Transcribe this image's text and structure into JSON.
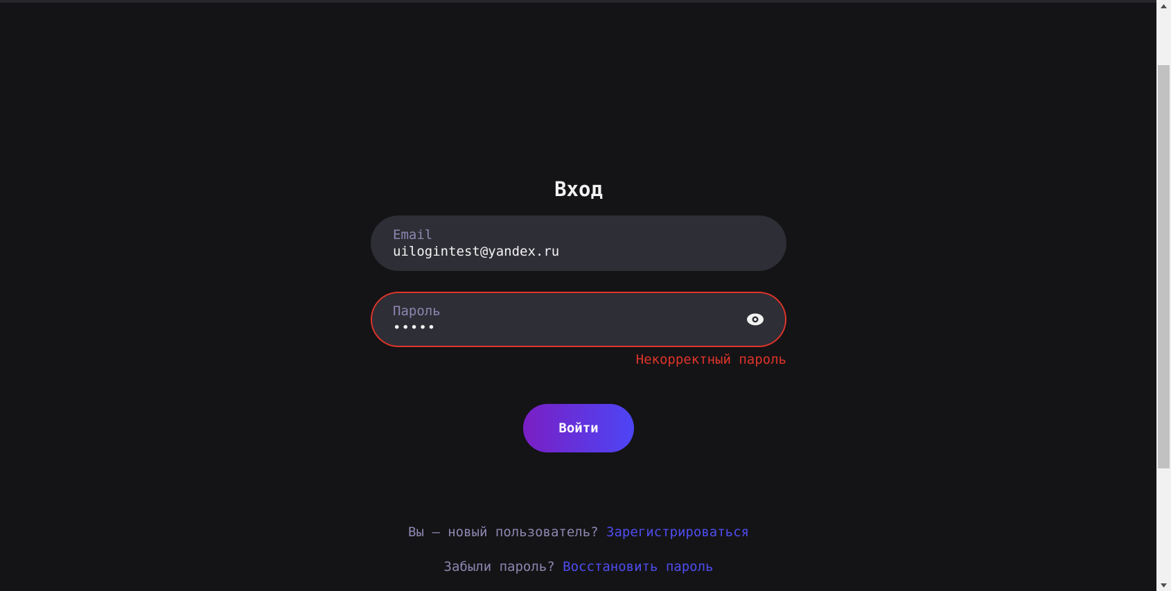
{
  "page": {
    "title": "Вход"
  },
  "form": {
    "email": {
      "label": "Email",
      "value": "uilogintest@yandex.ru"
    },
    "password": {
      "label": "Пароль",
      "masked_value": "•••••",
      "toggle_icon": "eye-icon",
      "error": "Некорректный пароль"
    },
    "submit_label": "Войти"
  },
  "footer": {
    "register_prompt": "Вы — новый пользователь?",
    "register_link": "Зарегистрироваться",
    "forgot_prompt": "Забыли пароль?",
    "forgot_link": "Восстановить пароль"
  },
  "colors": {
    "background": "#141416",
    "field_background": "#2e2e36",
    "error": "#e0342a",
    "link": "#4f4cf0",
    "button_gradient_start": "#7a1fc4",
    "button_gradient_end": "#4d45f5",
    "muted_text": "#8e87b2"
  }
}
